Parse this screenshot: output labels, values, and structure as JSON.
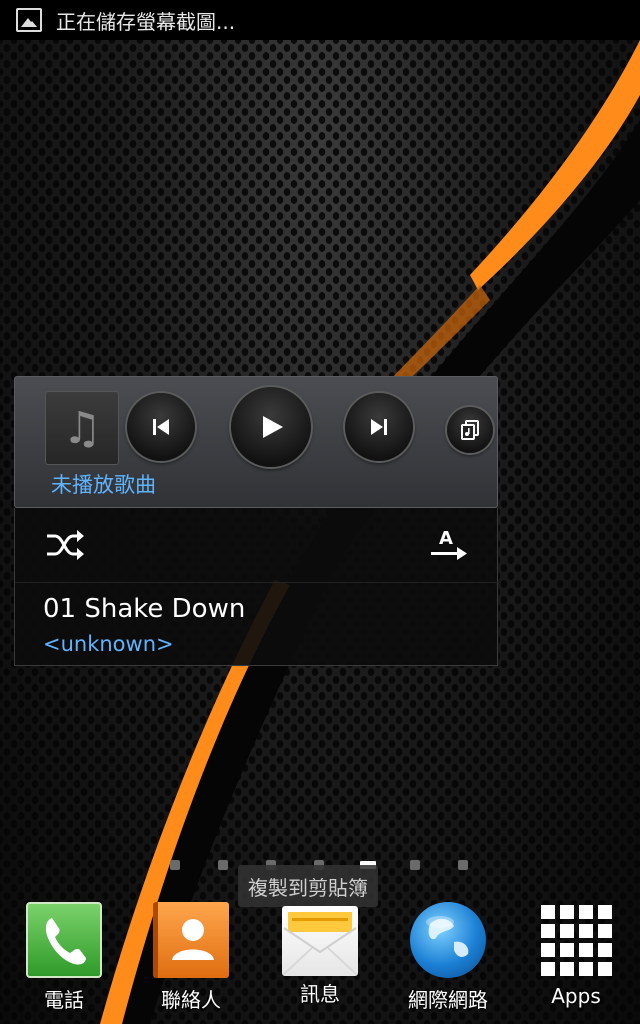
{
  "status_bar": {
    "notification_icon": "image-icon",
    "text": "正在儲存螢幕截圖..."
  },
  "music_widget": {
    "status_text": "未播放歌曲",
    "song_title": "01 Shake Down",
    "artist": "<unknown>",
    "controls": [
      "prev-icon",
      "play-icon",
      "next-icon",
      "playlist-icon"
    ],
    "shuffle_icon": "shuffle-icon",
    "sort_icon": "sort-alpha-icon"
  },
  "home": {
    "page_count": 7,
    "active_page_index": 5,
    "toast": "複製到剪貼簿"
  },
  "dock": {
    "items": [
      {
        "label": "電話",
        "icon": "phone-icon"
      },
      {
        "label": "聯絡人",
        "icon": "contacts-icon"
      },
      {
        "label": "訊息",
        "icon": "messages-icon"
      },
      {
        "label": "網際網路",
        "icon": "browser-icon"
      },
      {
        "label": "Apps",
        "icon": "apps-grid-icon"
      }
    ]
  },
  "colors": {
    "accent_orange": "#ff8c1a",
    "link_blue": "#5fb3ff",
    "phone_green": "#3fae35"
  }
}
